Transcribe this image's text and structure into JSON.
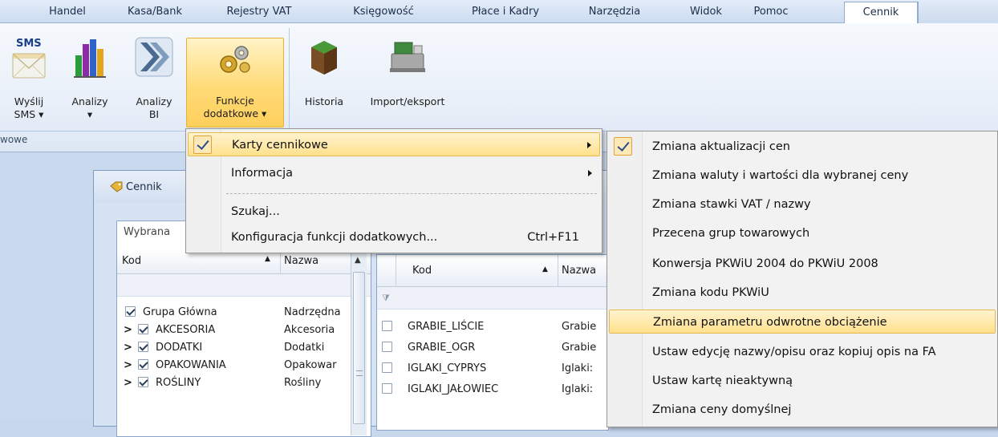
{
  "tabs": [
    "Handel",
    "Kasa/Bank",
    "Rejestry VAT",
    "Księgowość",
    "Płace i Kadry",
    "Narzędzia",
    "Widok",
    "Pomoc",
    "Cennik"
  ],
  "active_tab": "Cennik",
  "ribbon": {
    "buttons": [
      {
        "label1": "Wyślij",
        "label2": "SMS ▾",
        "icon": "sms-envelope-icon"
      },
      {
        "label1": "Analizy",
        "label2": "▾",
        "icon": "bar-chart-icon"
      },
      {
        "label1": "Analizy",
        "label2": "BI",
        "icon": "bi-arrows-icon"
      },
      {
        "label1": "Funkcje",
        "label2": "dodatkowe ▾",
        "icon": "gears-icon"
      },
      {
        "label1": "Historia",
        "label2": "",
        "icon": "history-box-icon"
      },
      {
        "label1": "Import/eksport",
        "label2": "",
        "icon": "cash-register-icon"
      }
    ],
    "group_label": "wowe"
  },
  "window": {
    "title": "Cennik",
    "left_panel": {
      "caption": "Wybrana",
      "columns": [
        "Kod",
        "Nazwa"
      ],
      "rows": [
        {
          "kod": "Grupa Główna",
          "nazwa": "Nadrzędna",
          "checked": true,
          "expand": ""
        },
        {
          "kod": "AKCESORIA",
          "nazwa": "Akcesoria",
          "checked": true,
          "expand": ">"
        },
        {
          "kod": "DODATKI",
          "nazwa": "Dodatki",
          "checked": true,
          "expand": ">"
        },
        {
          "kod": "OPAKOWANIA",
          "nazwa": "Opakowar",
          "checked": true,
          "expand": ">"
        },
        {
          "kod": "ROŚLINY",
          "nazwa": "Rośliny",
          "checked": true,
          "expand": ">"
        }
      ]
    },
    "right_panel": {
      "columns": [
        "Kod",
        "Nazwa"
      ],
      "rows": [
        {
          "kod": "GRABIE_LIŚCIE",
          "nazwa": "Grabie"
        },
        {
          "kod": "GRABIE_OGR",
          "nazwa": "Grabie"
        },
        {
          "kod": "IGLAKI_CYPRYS",
          "nazwa": "Iglaki:"
        },
        {
          "kod": "IGLAKI_JAŁOWIEC",
          "nazwa": "Iglaki:"
        }
      ]
    }
  },
  "menu": {
    "items": [
      {
        "label": "Karty cennikowe",
        "submenu": true,
        "checked": true,
        "highlighted": true
      },
      {
        "label": "Informacja",
        "submenu": true,
        "checked": false,
        "highlighted": false
      },
      {
        "label": "Szukaj...",
        "submenu": false,
        "checked": false,
        "highlighted": false
      },
      {
        "label": "Konfiguracja funkcji dodatkowych...",
        "shortcut": "Ctrl+F11",
        "submenu": false
      }
    ]
  },
  "submenu": {
    "items": [
      {
        "label": "Zmiana aktualizacji cen",
        "checked": true
      },
      {
        "label": "Zmiana waluty i wartości dla wybranej ceny"
      },
      {
        "label": "Zmiana stawki VAT / nazwy"
      },
      {
        "label": "Przecena grup towarowych"
      },
      {
        "label": "Konwersja PKWiU 2004 do PKWiU 2008"
      },
      {
        "label": "Zmiana kodu PKWiU"
      },
      {
        "label": "Zmiana parametru odwrotne obciążenie",
        "highlighted": true
      },
      {
        "label": "Ustaw edycję nazwy/opisu oraz kopiuj opis na FA"
      },
      {
        "label": "Ustaw kartę nieaktywną"
      },
      {
        "label": "Zmiana ceny domyślnej"
      }
    ]
  },
  "colors": {
    "highlight_top": "#fff4cf",
    "highlight_bottom": "#ffe08c",
    "highlight_border": "#e6b74c",
    "ribbon_bg": "#e9f0f9"
  }
}
